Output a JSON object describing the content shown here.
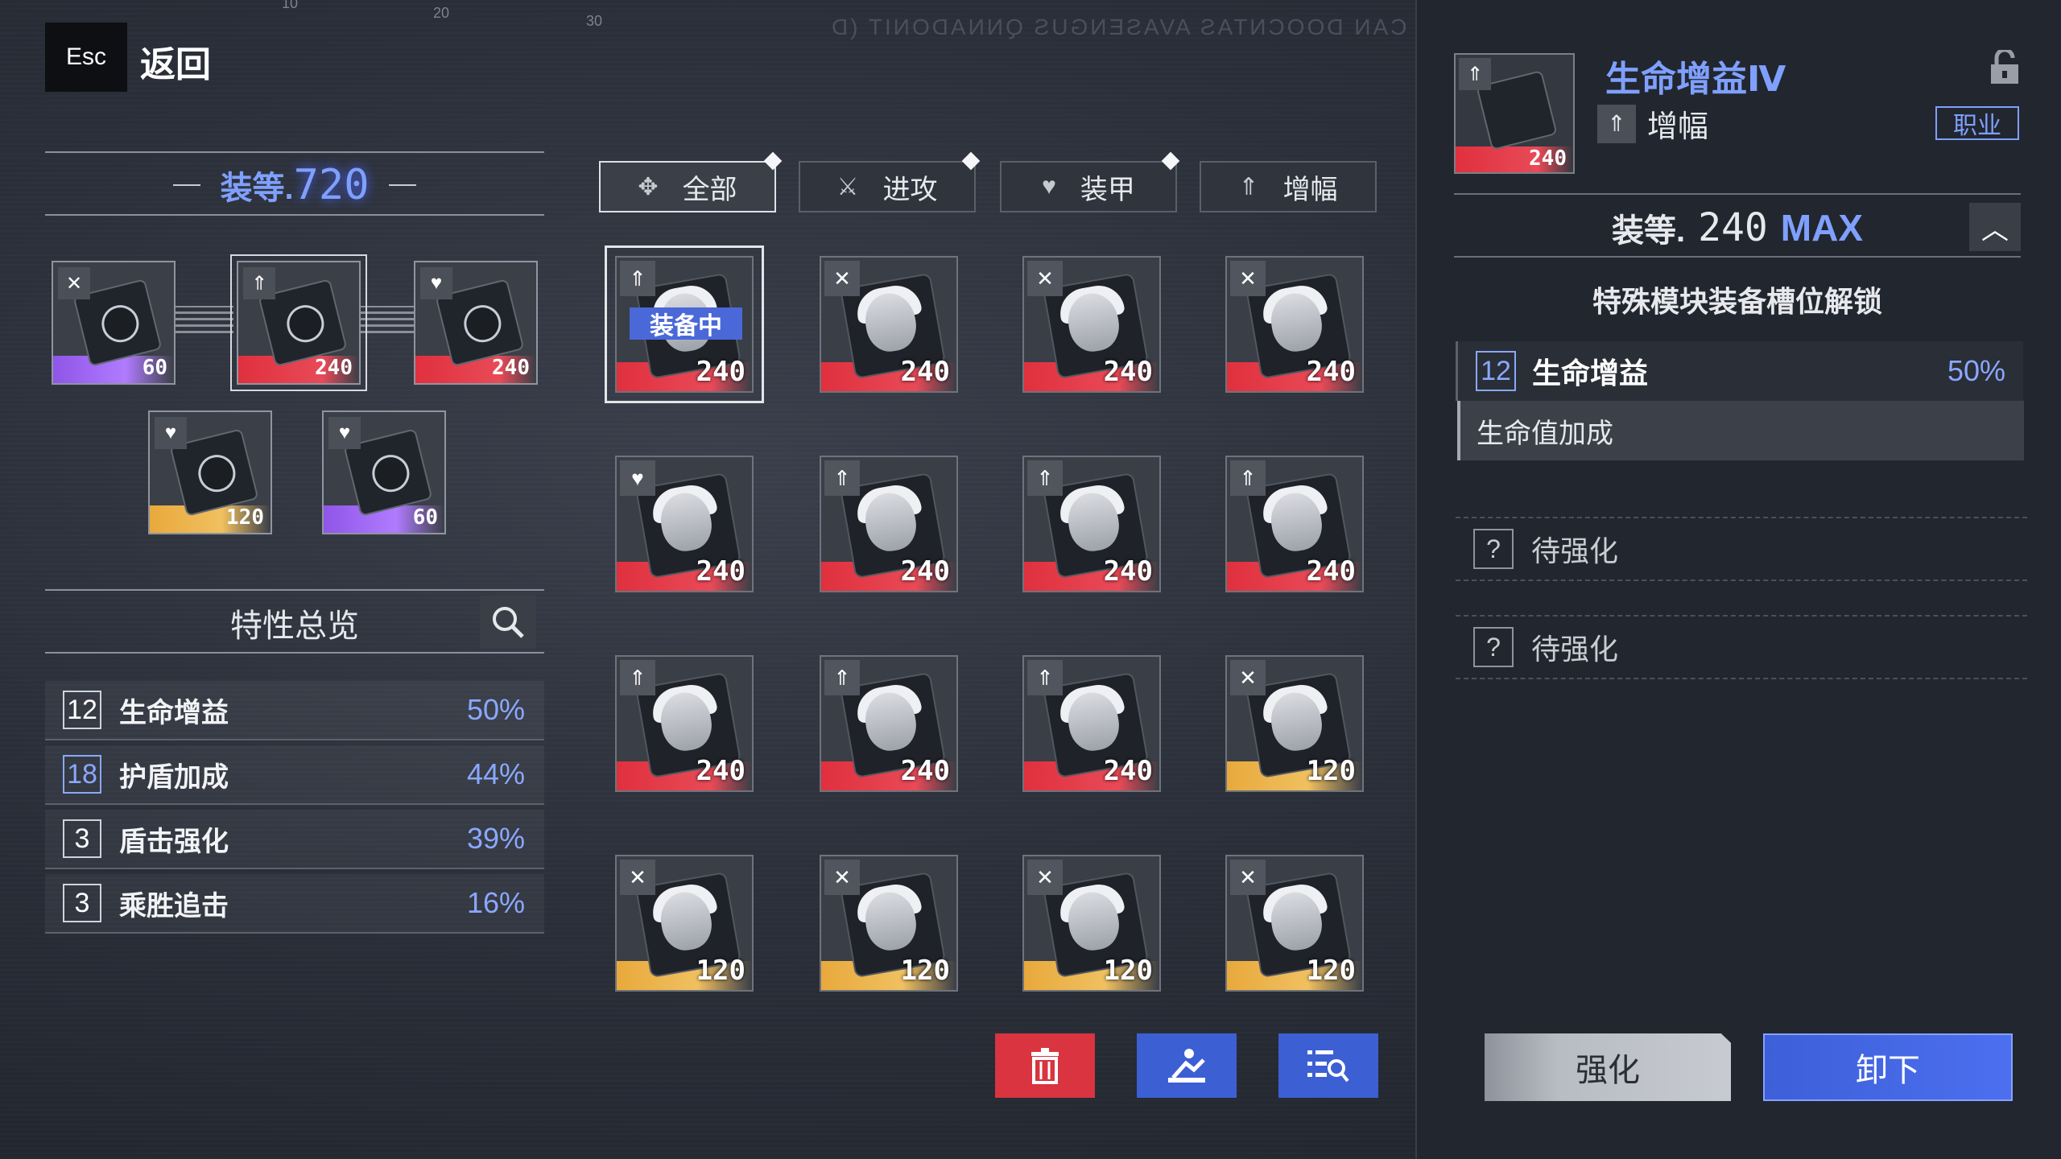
{
  "top": {
    "esc": "Esc",
    "back": "返回",
    "ruler_ticks": [
      "10",
      "20",
      "30"
    ],
    "code_text": "CAN DOOCNTAS AVASENGUS QNNADONIT (D"
  },
  "left": {
    "gear_label": "装等.",
    "gear_value": "720",
    "slots": [
      {
        "type": "attack",
        "icon": "sword-icon",
        "level": "60",
        "rarity": "purple"
      },
      {
        "type": "boost",
        "icon": "arrow-up-icon",
        "level": "240",
        "rarity": "red",
        "selected": true
      },
      {
        "type": "armor",
        "icon": "heart-shield-icon",
        "level": "240",
        "rarity": "red"
      },
      {
        "type": "armor",
        "icon": "heart-shield-icon",
        "level": "120",
        "rarity": "gold"
      },
      {
        "type": "armor",
        "icon": "heart-shield-icon",
        "level": "60",
        "rarity": "purple"
      }
    ],
    "traits_title": "特性总览",
    "traits": [
      {
        "num": "12",
        "name": "生命增益",
        "pct": "50%",
        "highlight": false
      },
      {
        "num": "18",
        "name": "护盾加成",
        "pct": "44%",
        "highlight": true
      },
      {
        "num": "3",
        "name": "盾击强化",
        "pct": "39%",
        "highlight": false
      },
      {
        "num": "3",
        "name": "乘胜追击",
        "pct": "16%",
        "highlight": false
      }
    ]
  },
  "tabs": [
    {
      "label": "全部",
      "icon": "✥",
      "active": true
    },
    {
      "label": "进攻",
      "icon": "⚔",
      "active": false
    },
    {
      "label": "装甲",
      "icon": "♥",
      "active": false
    },
    {
      "label": "增幅",
      "icon": "⇑",
      "active": false
    }
  ],
  "grid": [
    {
      "type": "boost",
      "level": "240",
      "rarity": "red",
      "equipped": true,
      "equipped_label": "装备中"
    },
    {
      "type": "attack",
      "level": "240",
      "rarity": "red"
    },
    {
      "type": "attack",
      "level": "240",
      "rarity": "red"
    },
    {
      "type": "attack",
      "level": "240",
      "rarity": "red"
    },
    {
      "type": "armor",
      "level": "240",
      "rarity": "red"
    },
    {
      "type": "boost",
      "level": "240",
      "rarity": "red"
    },
    {
      "type": "boost",
      "level": "240",
      "rarity": "red"
    },
    {
      "type": "boost",
      "level": "240",
      "rarity": "red"
    },
    {
      "type": "boost",
      "level": "240",
      "rarity": "red"
    },
    {
      "type": "boost",
      "level": "240",
      "rarity": "red"
    },
    {
      "type": "boost",
      "level": "240",
      "rarity": "red"
    },
    {
      "type": "attack",
      "level": "120",
      "rarity": "gold"
    },
    {
      "type": "attack",
      "level": "120",
      "rarity": "gold"
    },
    {
      "type": "attack",
      "level": "120",
      "rarity": "gold"
    },
    {
      "type": "attack",
      "level": "120",
      "rarity": "gold"
    },
    {
      "type": "attack",
      "level": "120",
      "rarity": "gold"
    }
  ],
  "bottom_buttons": [
    {
      "name": "delete-button",
      "icon": "trash-icon",
      "color": "#d9343f"
    },
    {
      "name": "auto-equip-button",
      "icon": "auto-equip-icon",
      "color": "#3c5fd4"
    },
    {
      "name": "filter-list-button",
      "icon": "list-search-icon",
      "color": "#3c5fd4"
    }
  ],
  "right": {
    "title": "生命增益Ⅳ",
    "type_label": "增幅",
    "job_label": "职业",
    "icon_level": "240",
    "gear_label": "装等.",
    "gear_value": "240",
    "gear_max": "MAX",
    "unlock_text": "特殊模块装备槽位解锁",
    "trait": {
      "num": "12",
      "name": "生命增益",
      "pct": "50%"
    },
    "trait_desc": "生命值加成",
    "pending": [
      {
        "q": "?",
        "label": "待强化"
      },
      {
        "q": "?",
        "label": "待强化"
      }
    ],
    "enhance_label": "强化",
    "unequip_label": "卸下"
  }
}
